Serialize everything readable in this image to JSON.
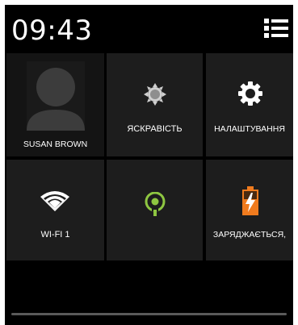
{
  "status_bar": {
    "time": "09:43",
    "menu_icon": "list-menu-icon"
  },
  "tiles": [
    {
      "label": "SUSAN BROWN",
      "icon": "user-avatar-icon"
    },
    {
      "label": "ЯСКРАВІСТЬ",
      "icon": "brightness-icon"
    },
    {
      "label": "НАЛАШТУВАННЯ",
      "icon": "gear-icon"
    },
    {
      "label": "WI-FI 1",
      "icon": "wifi-icon"
    },
    {
      "label": "",
      "icon": "location-icon"
    },
    {
      "label": "ЗАРЯДЖАЄТЬСЯ,",
      "icon": "battery-charging-icon"
    }
  ],
  "colors": {
    "background": "#000000",
    "tile": "#1d1d1d",
    "location_accent": "#8ec641",
    "battery_accent": "#f07b1e"
  }
}
